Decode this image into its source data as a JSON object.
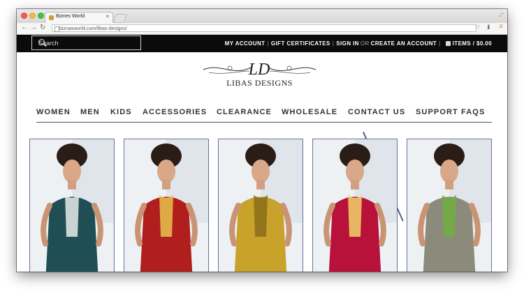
{
  "browser": {
    "tab_title": "Biznes World",
    "url": "biznasworld.com/libas-designs/"
  },
  "topbar": {
    "search_placeholder": "Search",
    "my_account": "MY ACCOUNT",
    "gift_certificates": "GIFT CERTIFICATES",
    "sign_in": "SIGN IN",
    "or": "OR",
    "create_account": "CREATE AN ACCOUNT",
    "items": "ITEMS / $0.00"
  },
  "logo": {
    "monogram": "LD",
    "name": "LIBAS DESIGNS"
  },
  "nav": {
    "items": [
      "WOMEN",
      "MEN",
      "KIDS",
      "ACCESSORIES",
      "CLEARANCE",
      "WHOLESALE",
      "CONTACT US",
      "SUPPORT FAQS"
    ]
  },
  "products": [
    {
      "dress_color": "#1f4f55",
      "accent": "#e9e9e9"
    },
    {
      "dress_color": "#b01e1e",
      "accent": "#e8c34c"
    },
    {
      "dress_color": "#c9a22b",
      "accent": "#8a6d1a"
    },
    {
      "dress_color": "#b8113a",
      "accent": "#f0d36b"
    },
    {
      "dress_color": "#8c8a7b",
      "accent": "#6fae3e"
    }
  ],
  "colors": {
    "topbar_bg": "#0b0b0b",
    "nav_text": "#333333"
  }
}
